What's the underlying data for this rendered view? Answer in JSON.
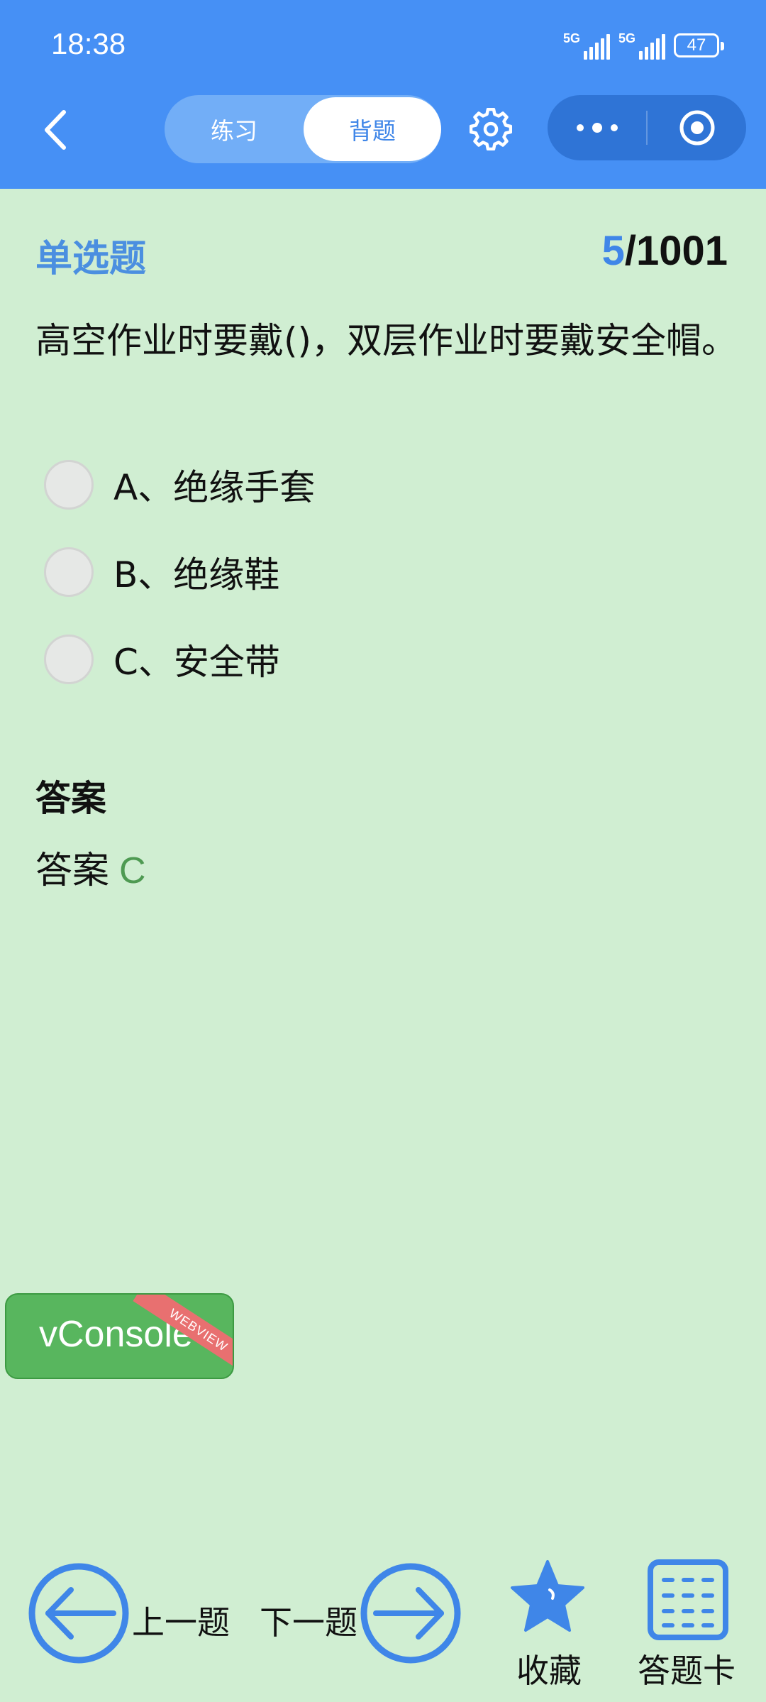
{
  "status_bar": {
    "time": "18:38",
    "network_1": "5G",
    "network_2": "5G",
    "battery": "47"
  },
  "nav": {
    "tabs": [
      {
        "label": "练习",
        "active": false
      },
      {
        "label": "背题",
        "active": true
      }
    ],
    "icons": [
      "back-arrow-icon",
      "gear-icon",
      "more-dots-icon",
      "target-icon"
    ]
  },
  "question": {
    "type": "单选题",
    "current": "5",
    "total": "/1001",
    "text": "高空作业时要戴()，双层作业时要戴安全帽。",
    "options": [
      {
        "label": "A、绝缘手套"
      },
      {
        "label": "B、绝缘鞋"
      },
      {
        "label": "C、安全带"
      }
    ]
  },
  "answer": {
    "title": "答案",
    "prefix": "答案",
    "value": "C"
  },
  "vconsole": {
    "label": "vConsole",
    "ribbon": "WEBVIEW"
  },
  "bottom_bar": {
    "prev": "上一题",
    "next": "下一题",
    "favorite": "收藏",
    "answer_card": "答题卡"
  },
  "colors": {
    "header_bg": "#4690f5",
    "page_bg": "#d0eed2",
    "accent_blue": "#3f86e8",
    "answer_green": "#4e9a52",
    "vconsole_green": "#58b65e"
  }
}
